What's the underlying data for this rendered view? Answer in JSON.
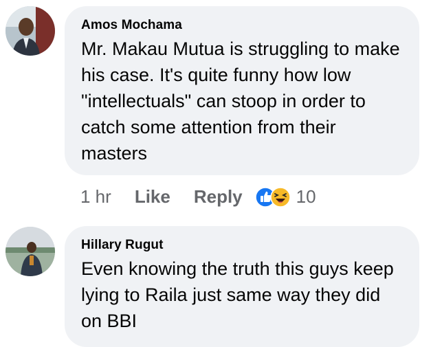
{
  "comments": [
    {
      "author": "Amos Mochama",
      "text": "Mr. Makau Mutua is struggling to make his case. It's quite funny how low \"intellectuals\" can stoop in order to catch some attention from their masters",
      "time": "1 hr",
      "like_label": "Like",
      "reply_label": "Reply",
      "reactions": [
        "like-icon",
        "haha-icon"
      ],
      "reaction_count": "10"
    },
    {
      "author": "Hillary Rugut",
      "text": "Even knowing the truth this guys keep lying to Raila just same way they did on BBI"
    }
  ],
  "colors": {
    "bubble": "#f0f2f5",
    "text": "#050505",
    "meta": "#65676b",
    "like_blue": "#1877f2",
    "haha_yellow": "#f7b928"
  }
}
